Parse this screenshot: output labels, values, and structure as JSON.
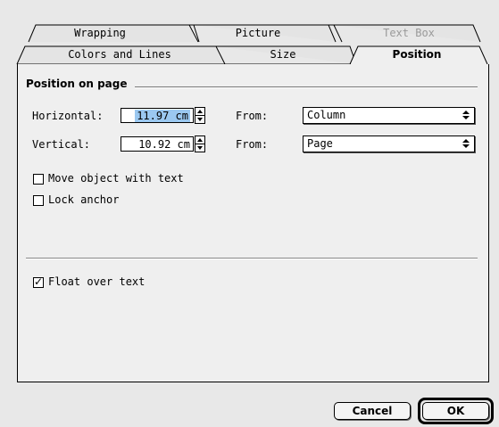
{
  "tabs_back": [
    {
      "label": "Wrapping",
      "enabled": true
    },
    {
      "label": "Picture",
      "enabled": true
    },
    {
      "label": "Text Box",
      "enabled": false
    }
  ],
  "tabs_front": [
    {
      "label": "Colors and Lines"
    },
    {
      "label": "Size"
    },
    {
      "label": "Position",
      "active": true
    }
  ],
  "group": {
    "title": "Position on page"
  },
  "horizontal": {
    "label": "Horizontal:",
    "value": "11.97 cm",
    "from_label": "From:",
    "from_value": "Column"
  },
  "vertical": {
    "label": "Vertical:",
    "value": "10.92 cm",
    "from_label": "From:",
    "from_value": "Page"
  },
  "options": {
    "move_with_text": {
      "label": "Move object with text",
      "checked": false
    },
    "lock_anchor": {
      "label": "Lock anchor",
      "checked": false
    },
    "float_over_text": {
      "label": "Float over text",
      "checked": true
    }
  },
  "buttons": {
    "cancel": "Cancel",
    "ok": "OK"
  },
  "colors": {
    "selection": "#9bc8f0",
    "background": "#e8e8e8"
  }
}
